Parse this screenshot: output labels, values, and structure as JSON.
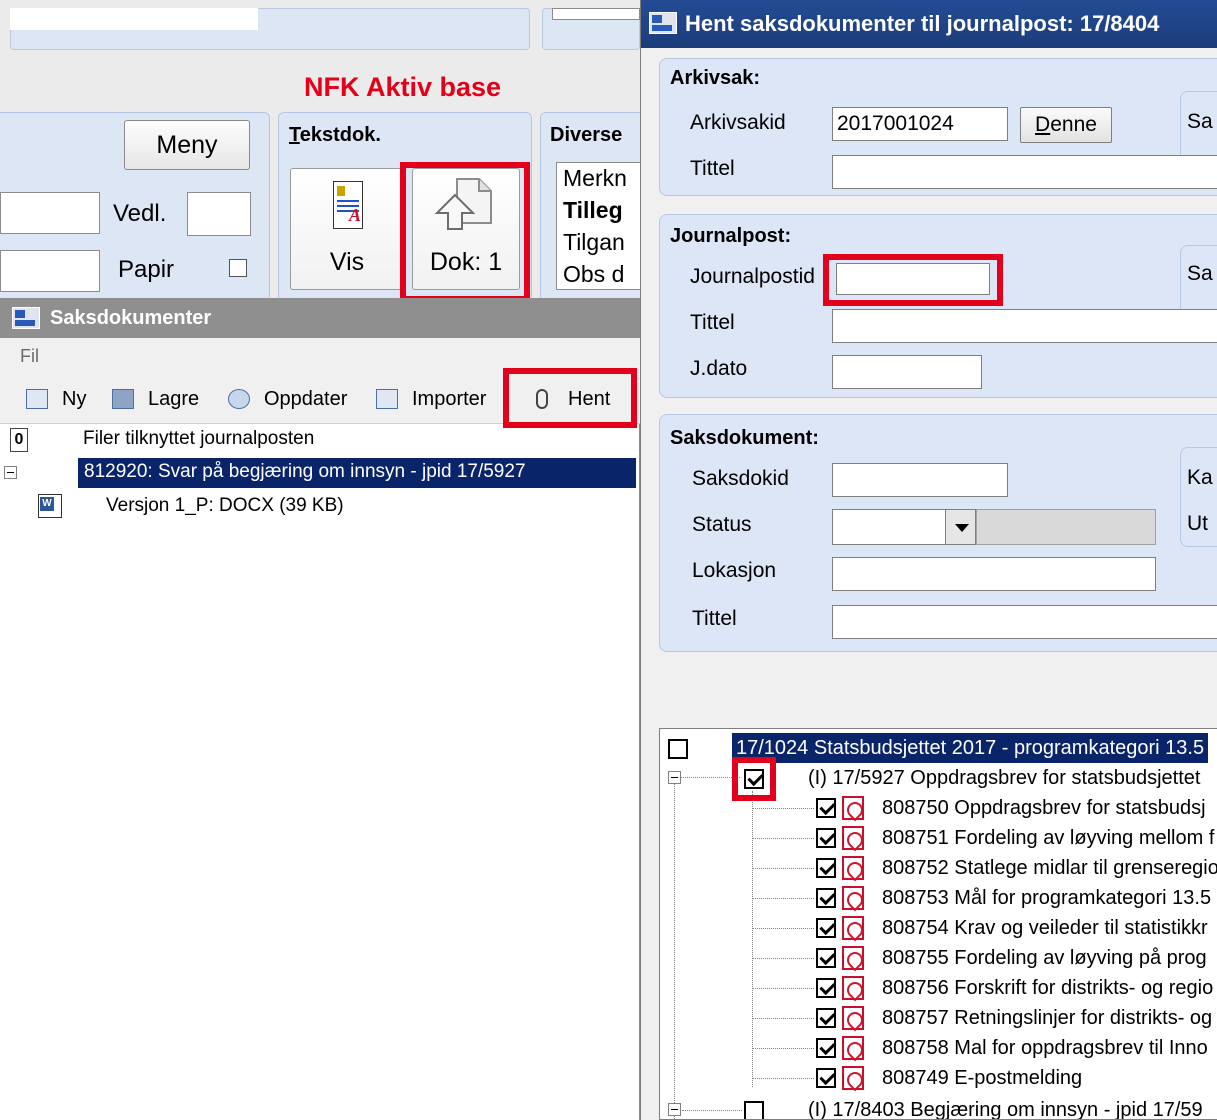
{
  "background_app": {
    "title": "NFK Aktiv base",
    "meny_label": "Meny",
    "vedl_label": "Vedl.",
    "papir_label": "Papir",
    "tekstdok_title": "Tekstdok.",
    "tekstdok_title_accesskey": "T",
    "vis_label": "Vis",
    "dok_label": "Dok: 1",
    "diverse_title": "Diverse",
    "diverse_items": [
      "Merkn",
      "Tilleg",
      "Tilgan",
      "Obs d"
    ]
  },
  "saksdokumenter": {
    "title": "Saksdokumenter",
    "menu_fil": "Fil",
    "toolbar": {
      "ny": "Ny",
      "lagre": "Lagre",
      "oppdater": "Oppdater",
      "importer": "Importer",
      "hent": "Hent"
    },
    "tree": {
      "header_count": "0",
      "header_text": "Filer tilknyttet journalposten",
      "selected_item": "812920: Svar på begjæring om innsyn - jpid 17/5927",
      "child_item": "Versjon 1_P: DOCX (39 KB)"
    }
  },
  "dialog": {
    "title": "Hent saksdokumenter til journalpost: 17/8404",
    "arkivsak": {
      "group_title": "Arkivsak:",
      "arkivsakid_label": "Arkivsakid",
      "arkivsakid_value": "2017001024",
      "denne_label": "Denne",
      "denne_accesskey": "D",
      "tittel_label": "Tittel",
      "tittel_value": "",
      "side_label": "Sa"
    },
    "journalpost": {
      "group_title": "Journalpost:",
      "journalpostid_label": "Journalpostid",
      "journalpostid_value": "",
      "tittel_label": "Tittel",
      "jdato_label": "J.dato",
      "side_label": "Sa"
    },
    "saksdokument": {
      "group_title": "Saksdokument:",
      "saksdokid_label": "Saksdokid",
      "status_label": "Status",
      "lokasjon_label": "Lokasjon",
      "tittel_label": "Tittel",
      "side_label_1": "Ka",
      "side_label_2": "Ut"
    },
    "tree": {
      "root": "17/1024 Statsbudsjettet 2017 - programkategori 13.5",
      "journal_entry": "(I) 17/5927 Oppdragsbrev for statsbudsjettet",
      "documents": [
        "808750 Oppdragsbrev for statsbudsj",
        "808751 Fordeling av løyving mellom f",
        "808752 Statlege midlar til grenseregio",
        "808753 Mål for programkategori 13.5",
        "808754 Krav og veileder til statistikkr",
        "808755 Fordeling av løyving på prog",
        "808756 Forskrift for distrikts- og regio",
        "808757 Retningslinjer for distrikts- og",
        "808758 Mal for oppdragsbrev til Inno",
        "808749 E-postmelding"
      ],
      "next_entry": "(I) 17/8403 Begjæring om innsyn - jpid 17/59"
    }
  }
}
